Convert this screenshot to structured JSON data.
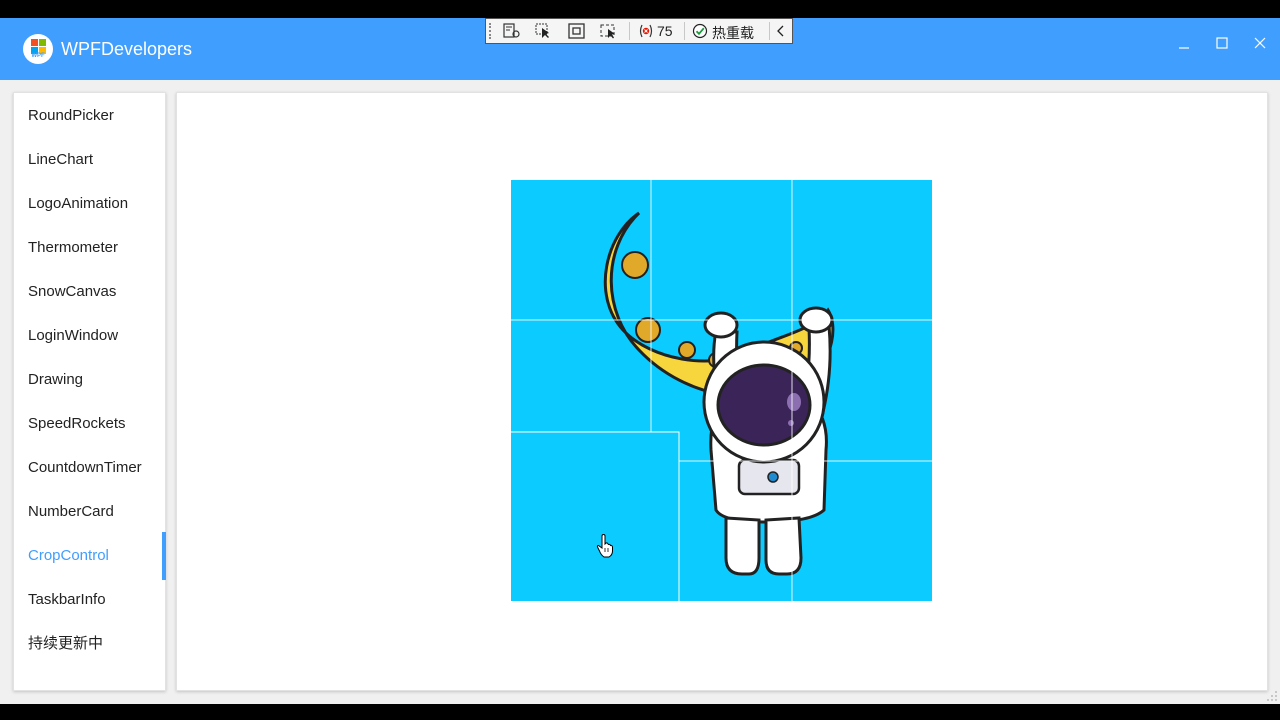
{
  "window": {
    "title": "WPFDevelopers",
    "logo_text": "WPF",
    "controls": {
      "minimize": "—",
      "maximize": "☐",
      "close": "✕"
    }
  },
  "debug_toolbar": {
    "count": "75",
    "hot_reload_label": "热重载",
    "collapse": "<"
  },
  "sidebar": {
    "items": [
      {
        "label": "RoundPicker",
        "active": false
      },
      {
        "label": "LineChart",
        "active": false
      },
      {
        "label": "LogoAnimation",
        "active": false
      },
      {
        "label": "Thermometer",
        "active": false
      },
      {
        "label": "SnowCanvas",
        "active": false
      },
      {
        "label": "LoginWindow",
        "active": false
      },
      {
        "label": "Drawing",
        "active": false
      },
      {
        "label": "SpeedRockets",
        "active": false
      },
      {
        "label": "CountdownTimer",
        "active": false
      },
      {
        "label": "NumberCard",
        "active": false
      },
      {
        "label": "CropControl",
        "active": true
      },
      {
        "label": "TaskbarInfo",
        "active": false
      },
      {
        "label": "持续更新中",
        "active": false
      }
    ]
  },
  "colors": {
    "accent": "#409eff",
    "puzzle_background": "#0ccbff",
    "moon": "#f7d53d",
    "moon_dark": "#e0a92a",
    "visor": "#3a2458"
  },
  "puzzle": {
    "grid": "3x3",
    "dragging_tile": "bottom-left"
  }
}
